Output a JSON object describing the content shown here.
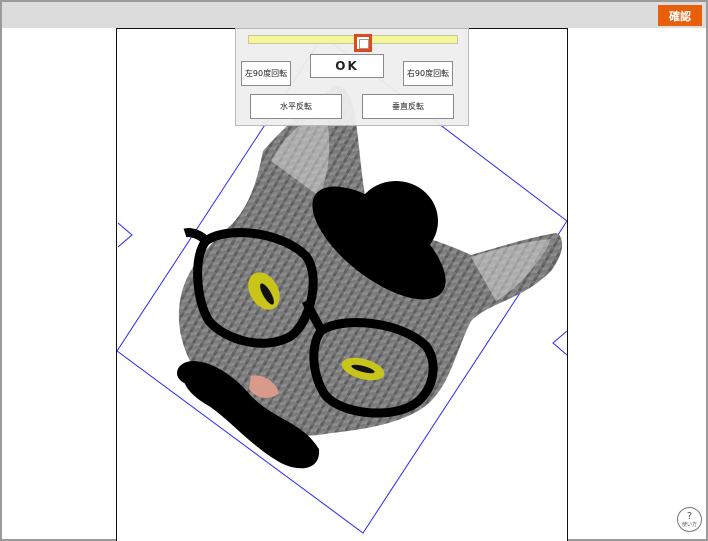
{
  "header": {
    "confirm_label": "確認"
  },
  "rotation_slider": {
    "value_fraction": 0.55
  },
  "control_panel": {
    "rotate_left_label": "左90度回転",
    "ok_label": "OK",
    "rotate_right_label": "右90度回転",
    "flip_horizontal_label": "水平反転",
    "flip_vertical_label": "垂直反転"
  },
  "help": {
    "icon": "?",
    "label": "使い方"
  },
  "colors": {
    "confirm_button": "#e8600c",
    "slider_handle_border": "#e1491d",
    "slider_track": "#f5f59a",
    "selection_outline": "#2a2aff"
  },
  "image": {
    "subject": "cat-with-bowler-hat-glasses-mustache"
  }
}
